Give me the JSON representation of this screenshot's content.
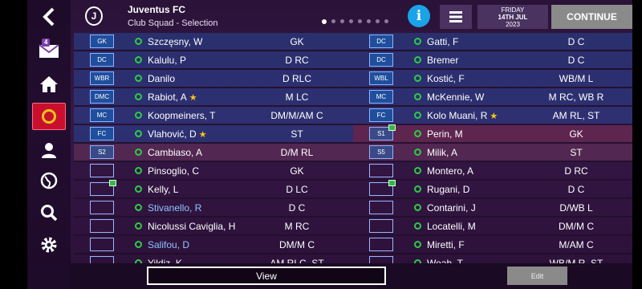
{
  "header": {
    "club_name": "Juventus FC",
    "subtitle": "Club Squad - Selection",
    "crest_letter": "J",
    "date_line1": "FRIDAY",
    "date_line2": "14TH JUL",
    "date_line3": "2023",
    "continue_label": "CONTINUE",
    "info_label": "i"
  },
  "sidebar": {
    "items": [
      {
        "icon": "back-icon"
      },
      {
        "icon": "mail-icon",
        "badge": "4"
      },
      {
        "icon": "home-icon"
      },
      {
        "icon": "club-badge-icon"
      },
      {
        "icon": "person-icon"
      },
      {
        "icon": "globe-icon"
      },
      {
        "icon": "search-icon"
      },
      {
        "icon": "gear-icon"
      }
    ]
  },
  "rows": [
    {
      "l_pos": "GK",
      "l_name": "Szczęsny, W",
      "l_position": "GK",
      "r_pos": "DC",
      "r_name": "Gatti, F",
      "r_position": "D C"
    },
    {
      "l_pos": "DC",
      "l_name": "Kalulu, P",
      "l_position": "D RC",
      "r_pos": "DC",
      "r_name": "Bremer",
      "r_position": "D C"
    },
    {
      "l_pos": "WBR",
      "l_name": "Danilo",
      "l_position": "D RLC",
      "r_pos": "WBL",
      "r_name": "Kostić, F",
      "r_position": "WB/M L"
    },
    {
      "l_pos": "DMC",
      "l_name": "Rabiot, A",
      "l_star": "★",
      "l_position": "M LC",
      "r_pos": "MC",
      "r_name": "McKennie, W",
      "r_position": "M RC, WB R"
    },
    {
      "l_pos": "MC",
      "l_name": "Koopmeiners, T",
      "l_position": "DM/M/AM C",
      "r_pos": "FC",
      "r_name": "Kolo Muani, R",
      "r_star": "★",
      "r_position": "AM RL, ST"
    },
    {
      "l_pos": "FC",
      "l_name": "Vlahović, D",
      "l_star": "★",
      "l_position": "ST",
      "r_pos": "S1",
      "r_name": "Perin, M",
      "r_position": "GK"
    },
    {
      "l_pos": "S2",
      "l_name": "Cambiaso, A",
      "l_position": "D/M RL",
      "r_pos": "S5",
      "r_name": "Milik, A",
      "r_position": "ST"
    },
    {
      "l_pos": "",
      "l_name": "Pinsoglio, C",
      "l_position": "GK",
      "r_pos": "",
      "r_name": "Montero, A",
      "r_position": "D RC"
    },
    {
      "l_pos": "",
      "l_name": "Kelly, L",
      "l_position": "D LC",
      "r_pos": "",
      "r_name": "Rugani, D",
      "r_position": "D C"
    },
    {
      "l_pos": "",
      "l_name": "Stivanello, R",
      "l_position": "D C",
      "r_pos": "",
      "r_name": "Contarini, J",
      "r_position": "D/WB L"
    },
    {
      "l_pos": "",
      "l_name": "Nicolussi Caviglia, H",
      "l_position": "M RC",
      "r_pos": "",
      "r_name": "Locatelli, M",
      "r_position": "DM/M C"
    },
    {
      "l_pos": "",
      "l_name": "Salifou, D",
      "l_position": "DM/M C",
      "r_pos": "",
      "r_name": "Miretti, F",
      "r_position": "M/AM C"
    },
    {
      "l_pos": "",
      "l_name": "Yildiz, K",
      "l_position": "AM RLC, ST",
      "r_pos": "",
      "r_name": "Weah, T",
      "r_position": "WB/M R, ST"
    }
  ],
  "bottom": {
    "view_label": "View",
    "edit_label": "Edit"
  },
  "colors": {
    "accent_blue": "#1aa3e8",
    "status_green": "#2ecb48",
    "star_gold": "#f5c518",
    "active_red": "#c8102e"
  }
}
